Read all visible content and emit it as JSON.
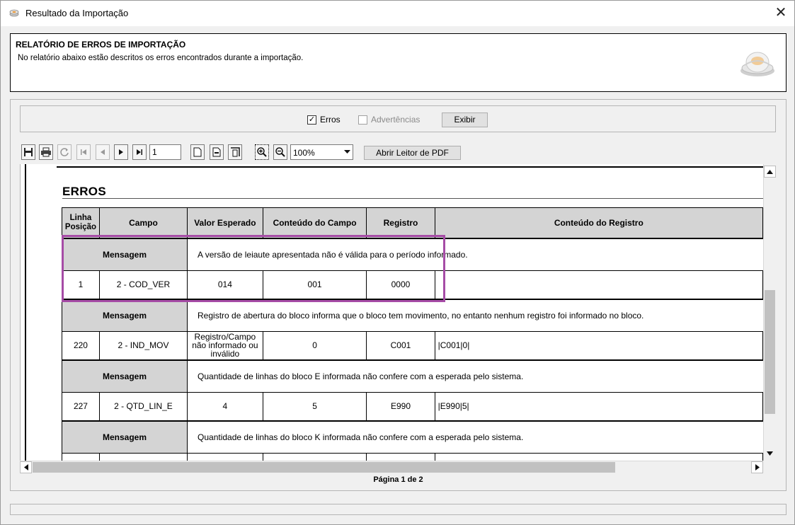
{
  "window": {
    "title": "Resultado da Importação",
    "close_glyph": "✕"
  },
  "header": {
    "title": "RELATÓRIO DE ERROS DE IMPORTAÇÃO",
    "subtitle": "No relatório abaixo estão descritos os erros encontrados durante a importação."
  },
  "filters": {
    "erros": {
      "label": "Erros",
      "checked": true
    },
    "advertencias": {
      "label": "Advertências",
      "checked": false,
      "enabled": false
    },
    "exibir_label": "Exibir"
  },
  "toolbar": {
    "page_value": "1",
    "zoom_value": "100%",
    "pdf_button_label": "Abrir Leitor de PDF",
    "icons": [
      "save-icon",
      "print-icon",
      "refresh-icon",
      "first-page-icon",
      "previous-page-icon",
      "next-page-icon",
      "last-page-icon",
      "single-page-icon",
      "page-width-icon",
      "full-page-icon",
      "zoom-in-icon",
      "zoom-out-icon"
    ]
  },
  "report": {
    "section_title": "ERROS",
    "columns": {
      "linha_posicao": "Linha Posição",
      "campo": "Campo",
      "valor_esperado": "Valor Esperado",
      "conteudo_campo": "Conteúdo do Campo",
      "registro": "Registro",
      "conteudo_registro": "Conteúdo do Registro"
    },
    "message_label": "Mensagem",
    "errors": [
      {
        "mensagem": "A versão de leiaute apresentada não é válida para o período informado.",
        "linha": "1",
        "campo": "2 - COD_VER",
        "valor_esperado": "014",
        "conteudo_campo": "001",
        "registro": "0000",
        "conteudo_registro": ""
      },
      {
        "mensagem": "Registro de abertura do bloco informa que o bloco tem movimento, no entanto nenhum registro foi informado no bloco.",
        "linha": "220",
        "campo": "2 - IND_MOV",
        "valor_esperado": "Registro/Campo não informado ou inválido",
        "conteudo_campo": "0",
        "registro": "C001",
        "conteudo_registro": "|C001|0|"
      },
      {
        "mensagem": "Quantidade de linhas do bloco E informada não confere com a esperada pelo sistema.",
        "linha": "227",
        "campo": "2 - QTD_LIN_E",
        "valor_esperado": "4",
        "conteudo_campo": "5",
        "registro": "E990",
        "conteudo_registro": "|E990|5|"
      },
      {
        "mensagem": "Quantidade de linhas do bloco K informada não confere com a esperada pelo sistema."
      }
    ]
  },
  "footer": {
    "page_indicator": "Página 1 de 2"
  },
  "colors": {
    "highlight": "#a64ca6",
    "header_cell": "#d4d4d4"
  }
}
